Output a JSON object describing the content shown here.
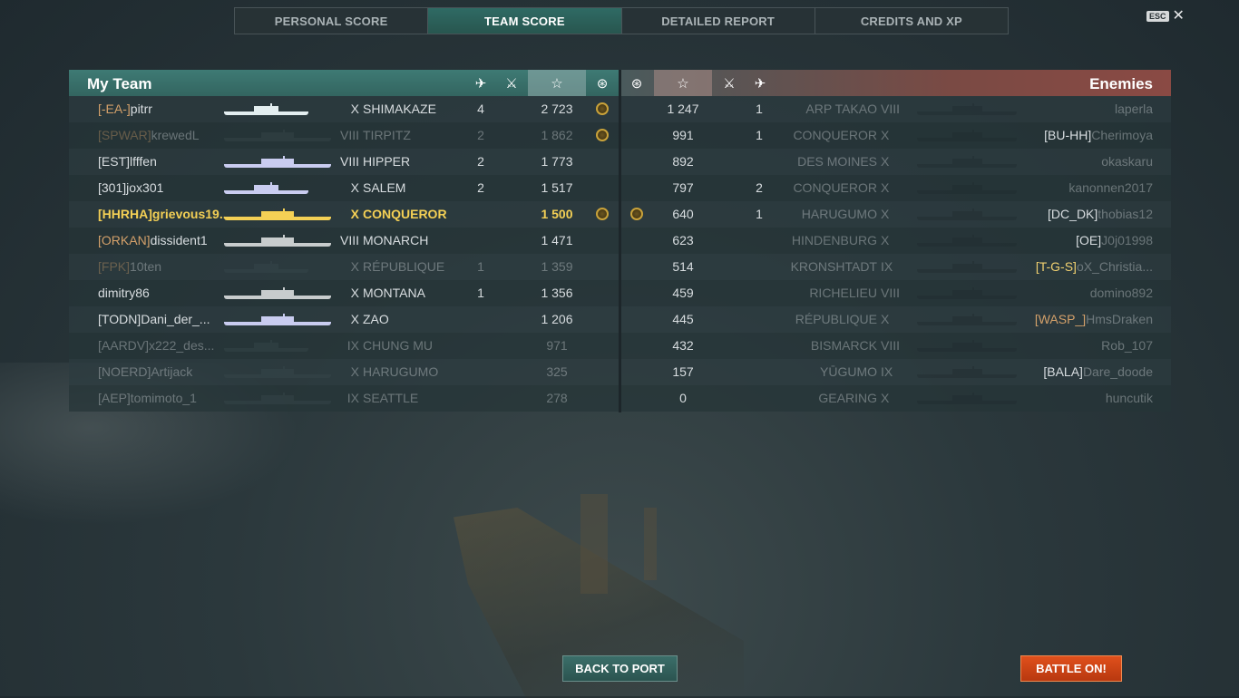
{
  "tabs": [
    {
      "label": "PERSONAL SCORE",
      "active": false
    },
    {
      "label": "TEAM SCORE",
      "active": true
    },
    {
      "label": "DETAILED REPORT",
      "active": false
    },
    {
      "label": "CREDITS AND XP",
      "active": false
    }
  ],
  "esc": {
    "key": "ESC",
    "close_icon": "close-icon"
  },
  "my_team": {
    "title": "My Team",
    "header_icons": [
      "planes-destroyed-icon",
      "kills-icon",
      "xp-star-icon",
      "achievement-medal-icon"
    ],
    "rows": [
      {
        "clan": "[-EA-]",
        "name": "pitrr",
        "tier": "X",
        "ship": "SHIMAKAZE",
        "kills": "4",
        "score": "2 723",
        "medal": true,
        "alive": true,
        "clan_color": "#d3a06a",
        "silhouette": "#e3eef0"
      },
      {
        "clan": "[SPWAR]",
        "name": "krewedL",
        "tier": "VIII",
        "ship": "TIRPITZ",
        "kills": "2",
        "score": "1 862",
        "medal": true,
        "alive": false,
        "clan_color": "#d3a06a",
        "silhouette": "#3a4a4e"
      },
      {
        "clan": "[EST]",
        "name": "lfffen",
        "tier": "VIII",
        "ship": "HIPPER",
        "kills": "2",
        "score": "1 773",
        "medal": false,
        "alive": true,
        "clan_color": "#d8dde0",
        "silhouette": "#c9ccf0"
      },
      {
        "clan": "[301]",
        "name": "jox301",
        "tier": "X",
        "ship": "SALEM",
        "kills": "2",
        "score": "1 517",
        "medal": false,
        "alive": true,
        "clan_color": "#d8dde0",
        "silhouette": "#c9ccf0"
      },
      {
        "clan": "[HHRHA]",
        "name": "grievous19...",
        "tier": "X",
        "ship": "CONQUEROR",
        "kills": "",
        "score": "1 500",
        "medal": true,
        "alive": true,
        "me": true,
        "clan_color": "#f4d055",
        "silhouette": "#f4d055"
      },
      {
        "clan": "[ORKAN]",
        "name": "dissident1",
        "tier": "VIII",
        "ship": "MONARCH",
        "kills": "",
        "score": "1 471",
        "medal": false,
        "alive": true,
        "clan_color": "#d3a06a",
        "silhouette": "#c8cccd"
      },
      {
        "clan": "[FPK]",
        "name": "10ten",
        "tier": "X",
        "ship": "RÉPUBLIQUE",
        "kills": "1",
        "score": "1 359",
        "medal": false,
        "alive": false,
        "clan_color": "#d3a06a",
        "silhouette": "#3a4a4e"
      },
      {
        "clan": "",
        "name": "dimitry86",
        "tier": "X",
        "ship": "MONTANA",
        "kills": "1",
        "score": "1 356",
        "medal": false,
        "alive": true,
        "clan_color": "#d8dde0",
        "silhouette": "#c8cccd"
      },
      {
        "clan": "[TODN]",
        "name": "Dani_der_...",
        "tier": "X",
        "ship": "ZAO",
        "kills": "",
        "score": "1 206",
        "medal": false,
        "alive": true,
        "clan_color": "#d8dde0",
        "silhouette": "#c9ccf0"
      },
      {
        "clan": "[AARDV]",
        "name": "x222_des...",
        "tier": "IX",
        "ship": "CHUNG MU",
        "kills": "",
        "score": "971",
        "medal": false,
        "alive": false,
        "clan_color": "#d8dde0",
        "silhouette": "#3a4a4e"
      },
      {
        "clan": "[NOERD]",
        "name": "Artijack",
        "tier": "X",
        "ship": "HARUGUMO",
        "kills": "",
        "score": "325",
        "medal": false,
        "alive": false,
        "clan_color": "#d8dde0",
        "silhouette": "#3a4a4e"
      },
      {
        "clan": "[AEP]",
        "name": "tomimoto_1",
        "tier": "IX",
        "ship": "SEATTLE",
        "kills": "",
        "score": "278",
        "medal": false,
        "alive": false,
        "clan_color": "#d8dde0",
        "silhouette": "#3a4a4e"
      }
    ]
  },
  "enemies": {
    "title": "Enemies",
    "header_icons": [
      "achievement-medal-icon",
      "xp-star-icon",
      "kills-icon",
      "planes-destroyed-icon"
    ],
    "rows": [
      {
        "medal": false,
        "score": "1 247",
        "kills": "1",
        "ship": "ARP TAKAO",
        "tier": "VIII",
        "clan": "",
        "name": "laperla",
        "alive": false,
        "clan_color": "#d8dde0"
      },
      {
        "medal": false,
        "score": "991",
        "kills": "1",
        "ship": "CONQUEROR",
        "tier": "X",
        "clan": "[BU-HH]",
        "name": "Cherimoya",
        "alive": false,
        "clan_color": "#d8dde0"
      },
      {
        "medal": false,
        "score": "892",
        "kills": "",
        "ship": "DES MOINES",
        "tier": "X",
        "clan": "",
        "name": "okaskaru",
        "alive": false,
        "clan_color": "#d8dde0"
      },
      {
        "medal": false,
        "score": "797",
        "kills": "2",
        "ship": "CONQUEROR",
        "tier": "X",
        "clan": "",
        "name": "kanonnen2017",
        "alive": false,
        "clan_color": "#d8dde0"
      },
      {
        "medal": true,
        "score": "640",
        "kills": "1",
        "ship": "HARUGUMO",
        "tier": "X",
        "clan": "[DC_DK]",
        "name": "thobias12",
        "alive": false,
        "clan_color": "#d8dde0"
      },
      {
        "medal": false,
        "score": "623",
        "kills": "",
        "ship": "HINDENBURG",
        "tier": "X",
        "clan": "[OE]",
        "name": "J0j01998",
        "alive": false,
        "clan_color": "#d8dde0"
      },
      {
        "medal": false,
        "score": "514",
        "kills": "",
        "ship": "KRONSHTADT",
        "tier": "IX",
        "clan": "[T-G-S]",
        "name": "oX_Christia...",
        "alive": false,
        "clan_color": "#f0d070"
      },
      {
        "medal": false,
        "score": "459",
        "kills": "",
        "ship": "RICHELIEU",
        "tier": "VIII",
        "clan": "",
        "name": "domino892",
        "alive": false,
        "clan_color": "#d8dde0"
      },
      {
        "medal": false,
        "score": "445",
        "kills": "",
        "ship": "RÉPUBLIQUE",
        "tier": "X",
        "clan": "[WASP_]",
        "name": "HmsDraken",
        "alive": false,
        "clan_color": "#d3a06a"
      },
      {
        "medal": false,
        "score": "432",
        "kills": "",
        "ship": "BISMARCK",
        "tier": "VIII",
        "clan": "",
        "name": "Rob_107",
        "alive": false,
        "clan_color": "#d8dde0"
      },
      {
        "medal": false,
        "score": "157",
        "kills": "",
        "ship": "YŪGUMO",
        "tier": "IX",
        "clan": "[BALA]",
        "name": "Dare_doode",
        "alive": false,
        "clan_color": "#d8dde0"
      },
      {
        "medal": false,
        "score": "0",
        "kills": "",
        "ship": "GEARING",
        "tier": "X",
        "clan": "",
        "name": "huncutik",
        "alive": false,
        "clan_color": "#d8dde0"
      }
    ]
  },
  "buttons": {
    "back_to_port": "BACK TO PORT",
    "battle_on": "BATTLE ON!"
  }
}
